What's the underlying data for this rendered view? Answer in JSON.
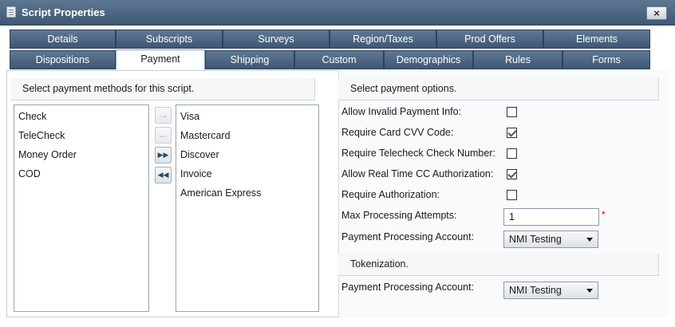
{
  "window": {
    "title": "Script Properties",
    "close_label": "×"
  },
  "tabs_row1": [
    "Details",
    "Subscripts",
    "Surveys",
    "Region/Taxes",
    "Prod Offers",
    "Elements"
  ],
  "tabs_row2": [
    "Dispositions",
    "Payment",
    "Shipping",
    "Custom",
    "Demographics",
    "Rules",
    "Forms"
  ],
  "active_tab": "Payment",
  "left": {
    "header": "Select payment methods for this script.",
    "available_methods": [
      "Check",
      "TeleCheck",
      "Money Order",
      "COD"
    ],
    "selected_methods": [
      "Visa",
      "Mastercard",
      "Discover",
      "Invoice",
      "American Express"
    ],
    "buttons": {
      "move_right": "→",
      "move_left": "←",
      "move_all_right": "▶▶",
      "move_all_left": "◀◀"
    }
  },
  "right": {
    "header": "Select payment options.",
    "options": [
      {
        "label": "Allow Invalid Payment Info:",
        "checked": false
      },
      {
        "label": "Require Card CVV Code:",
        "checked": true
      },
      {
        "label": "Require Telecheck Check Number:",
        "checked": false
      },
      {
        "label": "Allow Real Time CC Authorization:",
        "checked": true
      },
      {
        "label": "Require Authorization:",
        "checked": false
      }
    ],
    "max_attempts_label": "Max Processing Attempts:",
    "max_attempts_value": "1",
    "required_marker": "*",
    "account_label": "Payment Processing Account:",
    "account_value": "NMI Testing",
    "tokenization_header": "Tokenization.",
    "token_account_label": "Payment Processing Account:",
    "token_account_value": "NMI Testing"
  }
}
